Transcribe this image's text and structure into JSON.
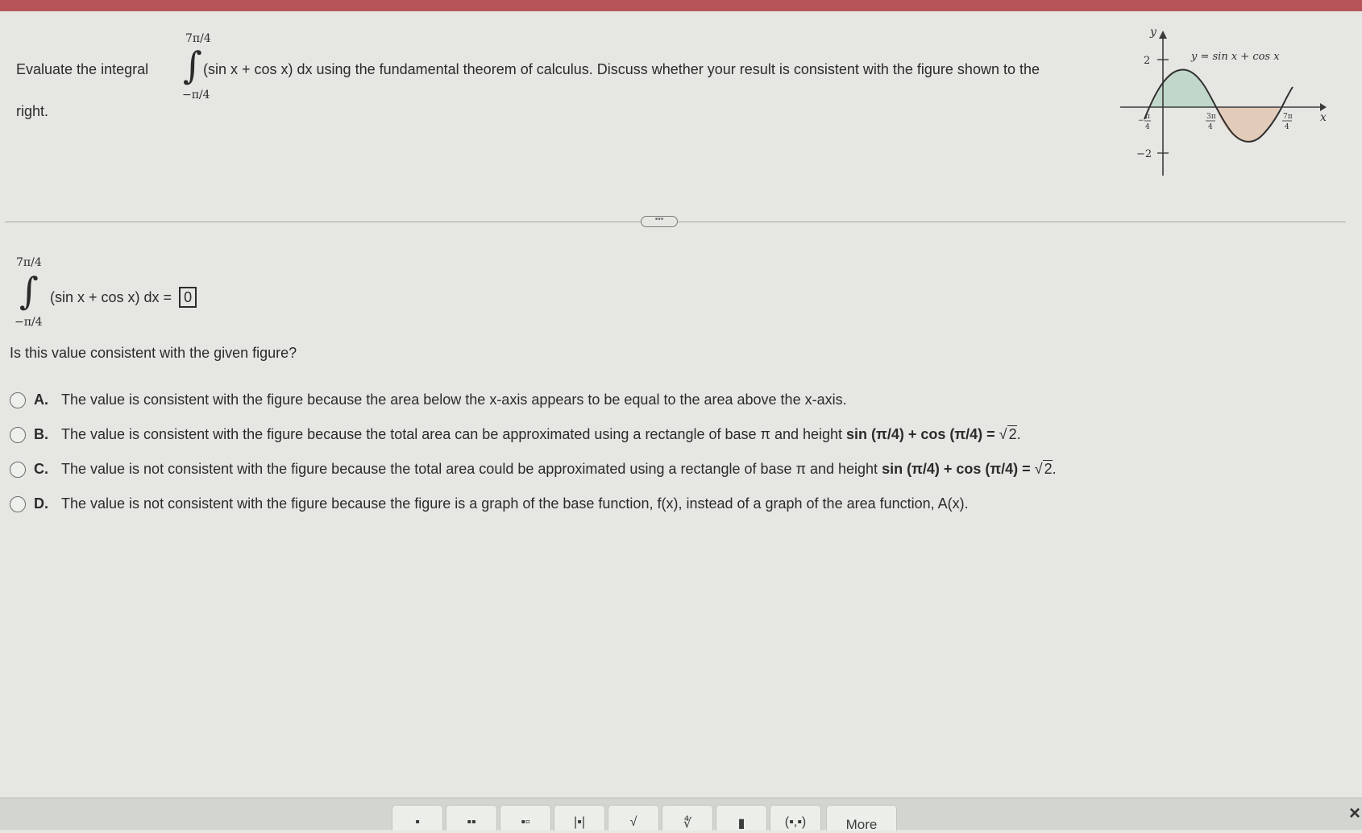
{
  "question": {
    "text_before": "Evaluate the integral",
    "integral_upper": "7π/4",
    "integral_lower": "−π/4",
    "text_after": "(sin x + cos x) dx using the fundamental theorem of calculus. Discuss whether your result is consistent with the figure shown to the",
    "text_wrap": "right."
  },
  "figure": {
    "y_axis": "y",
    "x_axis": "x",
    "curve_label": "y = sin x + cos x",
    "y_tick_top": "2",
    "y_tick_bottom": "−2",
    "x_ticks": [
      {
        "num": "π",
        "den": "4",
        "neg": true
      },
      {
        "num": "3π",
        "den": "4",
        "neg": false
      },
      {
        "num": "7π",
        "den": "4",
        "neg": false
      }
    ],
    "fill_color": "#b9d3c6",
    "curve_color": "#2f2f2f"
  },
  "answer": {
    "integral_upper": "7π/4",
    "integral_lower": "−π/4",
    "expression": "(sin x + cos x) dx =",
    "value": "0"
  },
  "consistency_question": "Is this value consistent with the given figure?",
  "options": [
    {
      "letter": "A.",
      "text": "The value is consistent with the figure because the area below the x-axis appears to be equal to the area above the x-axis."
    },
    {
      "letter": "B.",
      "text": "The value is consistent with the figure because the total area can be approximated using a rectangle of base π and height",
      "formula": "sin (π/4) + cos (π/4) =",
      "root": "2"
    },
    {
      "letter": "C.",
      "text": "The value is not consistent with the figure because the total area could be approximated using a rectangle of base π and height",
      "formula": "sin (π/4) + cos (π/4) =",
      "root": "2"
    },
    {
      "letter": "D.",
      "text": "The value is not consistent with the figure because the figure is a graph of the base function, f(x), instead of a graph of the area function, A(x)."
    }
  ],
  "toolbar": {
    "tools": [
      "▪",
      "▪▪",
      "▪▫",
      "|▪|",
      "√",
      "∜",
      "▮",
      "(▪,▪)"
    ],
    "more_label": "More"
  },
  "close_label": "×"
}
